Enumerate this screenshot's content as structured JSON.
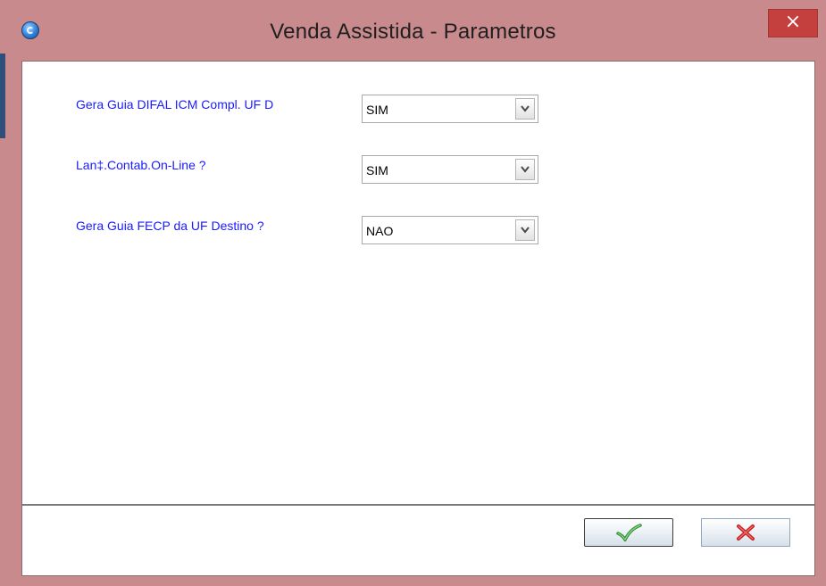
{
  "window": {
    "title": "Venda Assistida - Parametros",
    "close_label": "×",
    "app_icon": "app-logo-icon",
    "accent_color": "#c98a8e"
  },
  "params": [
    {
      "label": "Gera Guia DIFAL ICM Compl. UF D",
      "value": "SIM"
    },
    {
      "label": "Lan‡.Contab.On-Line ?",
      "value": "SIM"
    },
    {
      "label": "Gera Guia FECP da UF Destino ?",
      "value": "NAO"
    }
  ],
  "footer": {
    "ok_icon": "checkmark-icon",
    "cancel_icon": "cancel-x-icon",
    "ok_color": "#3aa63a",
    "cancel_color": "#d22a2a"
  }
}
